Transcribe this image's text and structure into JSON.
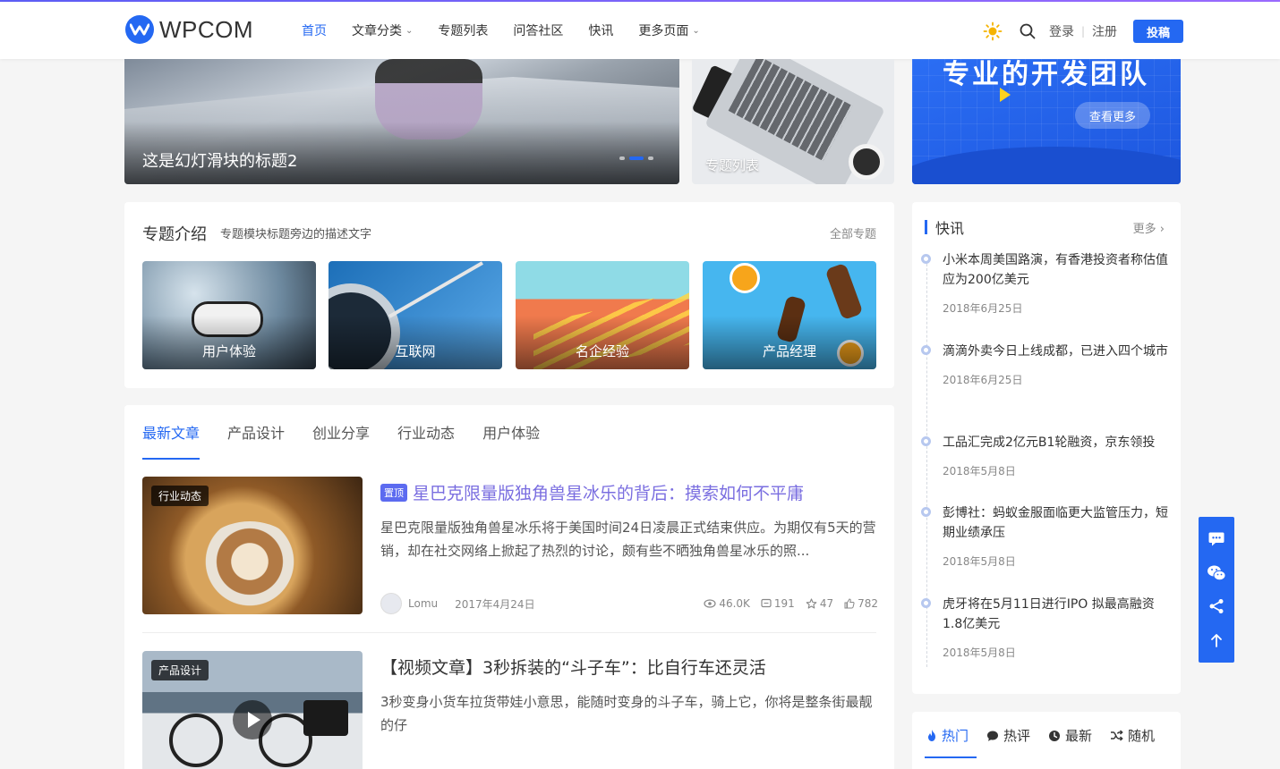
{
  "brand": {
    "name": "WPCOM",
    "accent": "#2468f2"
  },
  "nav": {
    "items": [
      {
        "label": "首页",
        "active": true,
        "has_menu": false
      },
      {
        "label": "文章分类",
        "active": false,
        "has_menu": true
      },
      {
        "label": "专题列表",
        "active": false,
        "has_menu": false
      },
      {
        "label": "问答社区",
        "active": false,
        "has_menu": false
      },
      {
        "label": "快讯",
        "active": false,
        "has_menu": false
      },
      {
        "label": "更多页面",
        "active": false,
        "has_menu": true
      }
    ],
    "login": "登录",
    "register": "注册",
    "submit": "投稿"
  },
  "slider": {
    "main_title": "这是幻灯滑块的标题2",
    "side_title": "专题列表",
    "promo_title": "专业的开发团队",
    "promo_button": "查看更多"
  },
  "topics": {
    "title": "专题介绍",
    "desc": "专题模块标题旁边的描述文字",
    "all": "全部专题",
    "cards": [
      {
        "label": "用户体验"
      },
      {
        "label": "互联网"
      },
      {
        "label": "名企经验"
      },
      {
        "label": "产品经理"
      }
    ]
  },
  "articles": {
    "tabs": [
      "最新文章",
      "产品设计",
      "创业分享",
      "行业动态",
      "用户体验"
    ],
    "posts": [
      {
        "category": "行业动态",
        "pin": "置顶",
        "title": "星巴克限量版独角兽星冰乐的背后：摸索如何不平庸",
        "excerpt": "星巴克限量版独角兽星冰乐将于美国时间24日凌晨正式结束供应。为期仅有5天的营销，却在社交网络上掀起了热烈的讨论，颇有些不晒独角兽星冰乐的照...",
        "author": "Lomu",
        "date": "2017年4月24日",
        "views": "46.0K",
        "comments": "191",
        "favorites": "47",
        "likes": "782"
      },
      {
        "category": "产品设计",
        "title": "【视频文章】3秒拆装的“斗子车”：比自行车还灵活",
        "excerpt": "3秒变身小货车拉货带娃小意思，能随时变身的斗子车，骑上它，你将是整条街最靓的仔"
      }
    ]
  },
  "flash": {
    "title": "快讯",
    "more": "更多",
    "items": [
      {
        "text": "小米本周美国路演，有香港投资者称估值应为200亿美元",
        "date": "2018年6月25日"
      },
      {
        "text": "滴滴外卖今日上线成都，已进入四个城市",
        "date": "2018年6月25日"
      },
      {
        "text": "工品汇完成2亿元B1轮融资，京东领投",
        "date": "2018年5月8日"
      },
      {
        "text": "彭博社：蚂蚁金服面临更大监管压力，短期业绩承压",
        "date": "2018年5月8日"
      },
      {
        "text": "虎牙将在5月11日进行IPO 拟最高融资1.8亿美元",
        "date": "2018年5月8日"
      }
    ]
  },
  "hot": {
    "tabs": [
      "热门",
      "热评",
      "最新",
      "随机"
    ]
  }
}
